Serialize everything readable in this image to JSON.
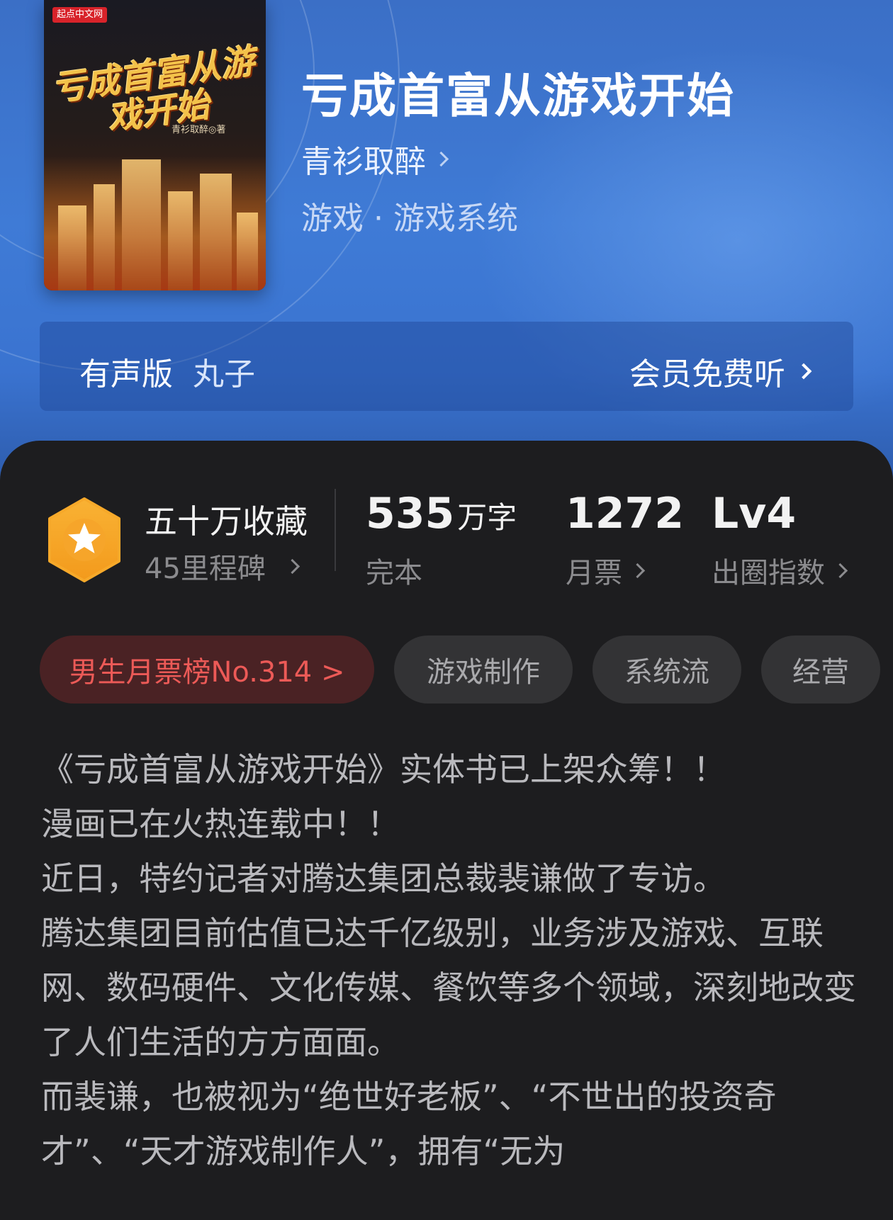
{
  "book": {
    "title": "亏成首富从游戏开始",
    "author": "青衫取醉",
    "genre": "游戏 · 游戏系统",
    "cover": {
      "publisher": "起点中文网",
      "title": "亏成首富从游戏开始",
      "author_line": "青衫取醉◎著"
    }
  },
  "audio": {
    "label": "有声版",
    "narrator": "丸子",
    "action": "会员免费听"
  },
  "stats": {
    "collection": {
      "main": "五十万收藏",
      "sub": "45里程碑"
    },
    "words": {
      "number": "535",
      "unit": "万字",
      "label": "完本"
    },
    "tickets": {
      "number": "1272",
      "label": "月票"
    },
    "level": {
      "number": "Lv4",
      "label": "出圈指数"
    }
  },
  "tags": [
    "男生月票榜No.314 >",
    "游戏制作",
    "系统流",
    "经营"
  ],
  "intro": [
    "《亏成首富从游戏开始》实体书已上架众筹！！",
    "漫画已在火热连载中！！",
    "近日，特约记者对腾达集团总裁裴谦做了专访。",
    "腾达集团目前估值已达千亿级别，业务涉及游戏、互联网、数码硬件、文化传媒、餐饮等多个领域，深刻地改变了人们生活的方方面面。",
    "而裴谦，也被视为“绝世好老板”、“不世出的投资奇才”、“天才游戏制作人”，拥有“无为"
  ],
  "colors": {
    "hero_blue": "#3f7bd6",
    "rank_red": "#ec5a57",
    "badge_orange": "#f5a623",
    "panel_dark": "#1d1d1f"
  }
}
